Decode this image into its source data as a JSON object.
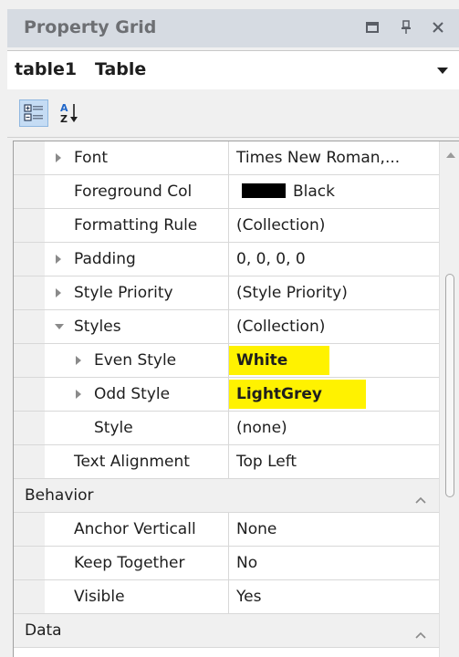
{
  "panel": {
    "title": "Property Grid",
    "icons": [
      "maximize-icon",
      "pin-icon",
      "close-icon"
    ]
  },
  "selector": {
    "value": "table1   Table"
  },
  "toolbar": {
    "categorized_icon": "categorized-view-icon",
    "alphabetical_icon": "sort-alphabetical-icon"
  },
  "grid": {
    "rows": [
      {
        "name": "Font",
        "value": "Times New Roman,...",
        "expander": "collapsed",
        "indent": 1
      },
      {
        "name": "Foreground Col",
        "value": "Black",
        "swatch": "#000000",
        "indent": 1
      },
      {
        "name": "Formatting Rule",
        "value": "(Collection)",
        "indent": 1
      },
      {
        "name": "Padding",
        "value": "0, 0, 0, 0",
        "expander": "collapsed",
        "indent": 1
      },
      {
        "name": "Style Priority",
        "value": "(Style Priority)",
        "expander": "collapsed",
        "indent": 1
      },
      {
        "name": "Styles",
        "value": "(Collection)",
        "expander": "expanded",
        "indent": 1
      },
      {
        "name": "Even Style",
        "value": "White",
        "expander": "collapsed",
        "indent": 2,
        "highlight": true
      },
      {
        "name": "Odd Style",
        "value": "LightGrey",
        "expander": "collapsed",
        "indent": 2,
        "highlight": true
      },
      {
        "name": "Style",
        "value": "(none)",
        "indent": 2
      },
      {
        "name": "Text Alignment",
        "value": "Top Left",
        "indent": 1
      }
    ],
    "behavior": {
      "label": "Behavior",
      "rows": [
        {
          "name": "Anchor Verticall",
          "value": "None"
        },
        {
          "name": "Keep Together",
          "value": "No"
        },
        {
          "name": "Visible",
          "value": "Yes"
        }
      ]
    },
    "data": {
      "label": "Data"
    }
  },
  "colors": {
    "highlight": "#fff200",
    "title_bar": "#d6dbe2",
    "active_tool": "#c5dcf4"
  }
}
